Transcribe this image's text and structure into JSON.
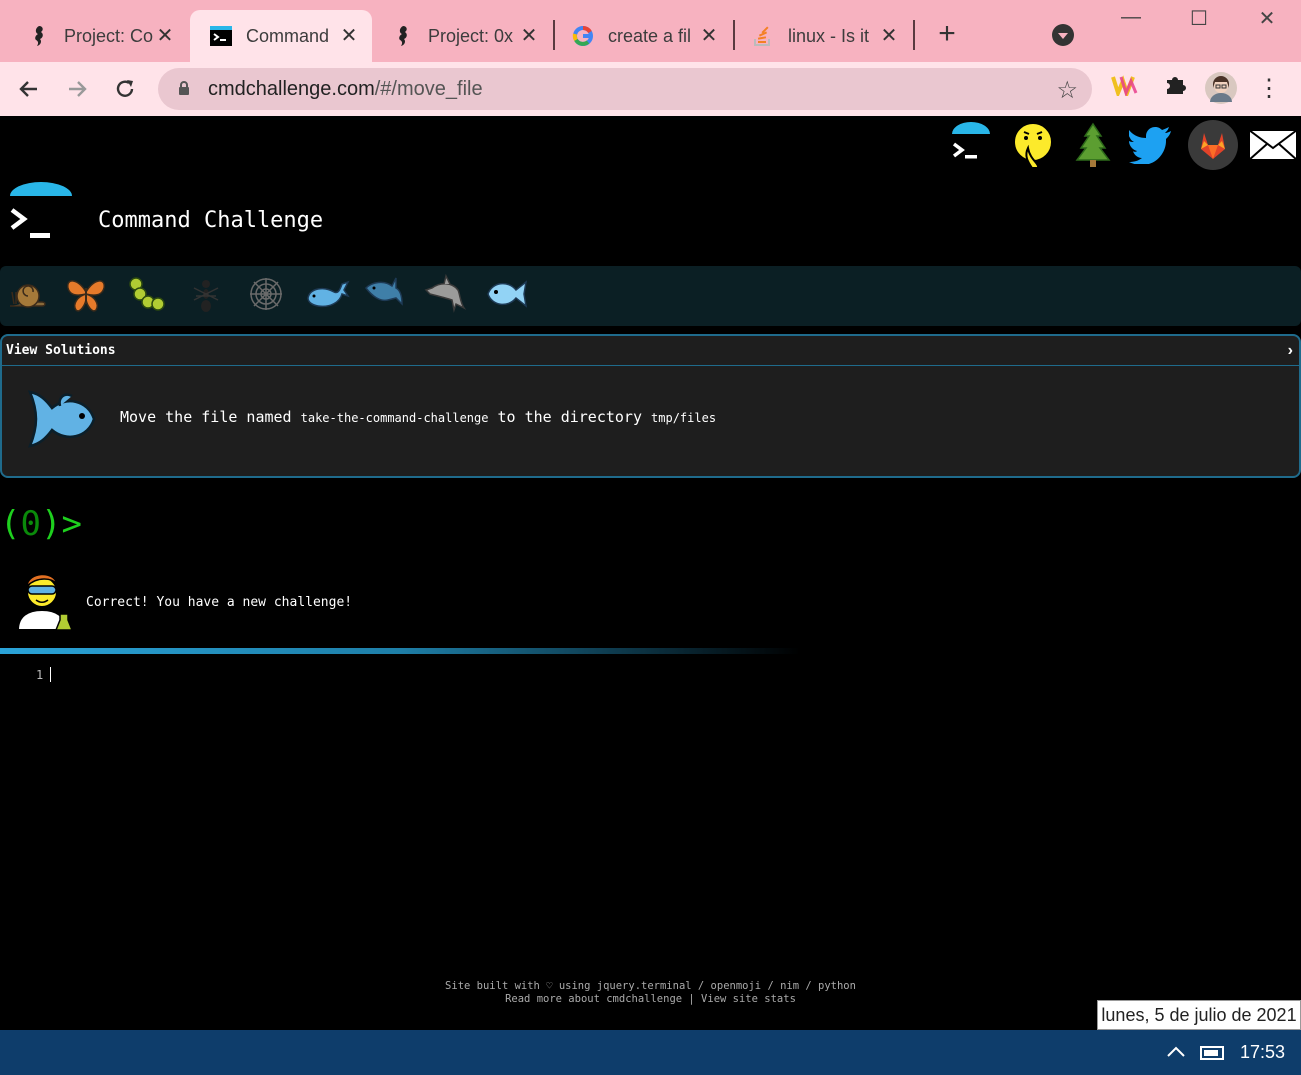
{
  "browser": {
    "tabs": [
      {
        "title": "Project: Co",
        "favicon": "seahorse-icon"
      },
      {
        "title": "Command",
        "favicon": "terminal-icon",
        "active": true
      },
      {
        "title": "Project: 0x",
        "favicon": "seahorse-icon"
      },
      {
        "title": "create a fil",
        "favicon": "google-icon"
      },
      {
        "title": "linux - Is it",
        "favicon": "stackoverflow-icon"
      }
    ],
    "url_host": "cmdchallenge.com",
    "url_path": "/#/move_file"
  },
  "site": {
    "title": "Command Challenge",
    "social_icons": [
      "terminal-icon",
      "shush-face-icon",
      "tree-icon",
      "twitter-icon",
      "gitlab-icon",
      "mail-icon"
    ],
    "levels": [
      "snail-icon",
      "butterfly-icon",
      "caterpillar-icon",
      "ant-icon",
      "spiderweb-icon",
      "whale-icon",
      "shark-icon",
      "dolphin-icon",
      "fish-icon"
    ]
  },
  "panel": {
    "header": "View Solutions",
    "task_prefix": "Move the file named",
    "task_file": "take-the-command-challenge",
    "task_middle": "to the directory",
    "task_dir": "tmp/files"
  },
  "terminal": {
    "prompt_open": "(",
    "prompt_count": "0",
    "prompt_close": ")>",
    "message": "Correct! You have a new challenge!",
    "line_number": "1"
  },
  "footer": {
    "line1": "Site built with ♡ using jquery.terminal / openmoji / nim / python",
    "line2": "Read more about cmdchallenge | View site stats"
  },
  "taskbar": {
    "date_tooltip": "lunes, 5 de julio de 2021",
    "time": "17:53"
  },
  "colors": {
    "tabbar": "#f7b2c0",
    "accent_blue": "#2aa3d8",
    "prompt_green": "#1ed01e",
    "taskbar": "#0e3d6b"
  }
}
